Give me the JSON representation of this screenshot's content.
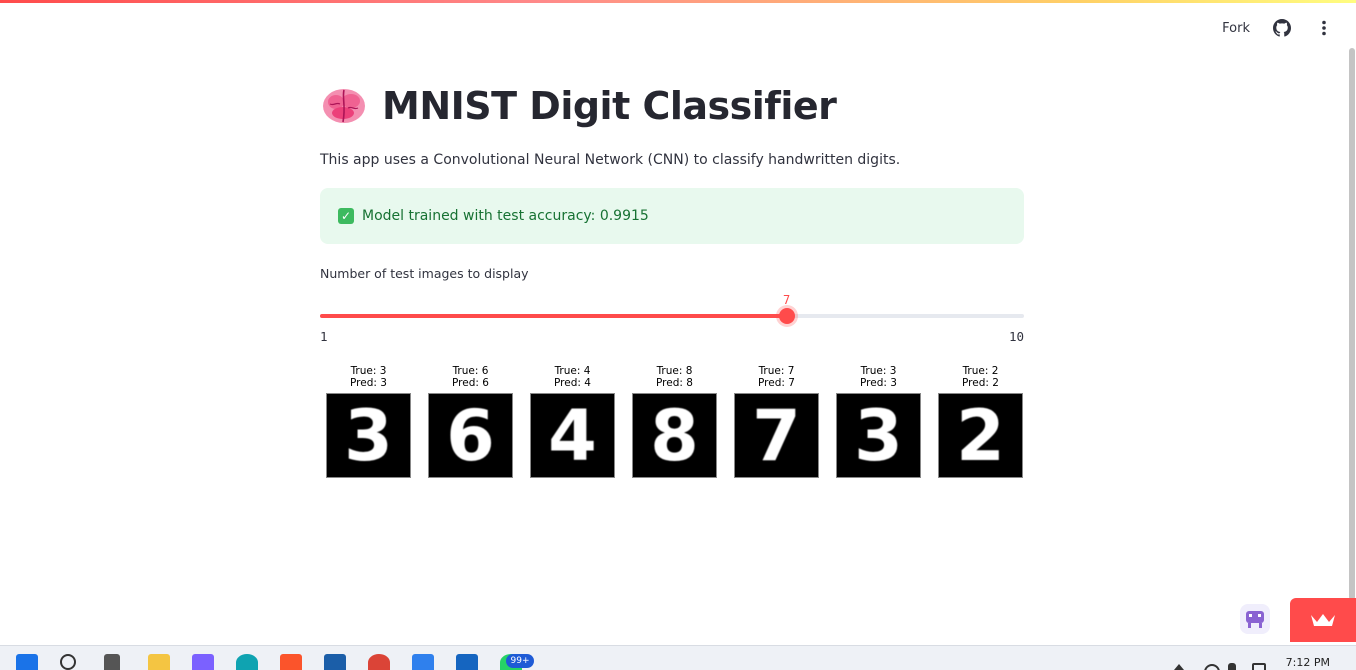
{
  "header": {
    "fork_label": "Fork",
    "icons": [
      "github-icon",
      "more-vertical-icon"
    ]
  },
  "app": {
    "title_emoji": "brain-icon",
    "title": "MNIST Digit Classifier",
    "description": "This app uses a Convolutional Neural Network (CNN) to classify handwritten digits.",
    "success_message": "Model trained with test accuracy: 0.9915",
    "slider": {
      "label": "Number of test images to display",
      "min": 1,
      "max": 10,
      "value": 7,
      "min_label": "1",
      "max_label": "10",
      "value_label": "7",
      "color": "#ff4b4b"
    },
    "samples": [
      {
        "true_label": "True: 3",
        "pred_label": "Pred: 3",
        "digit": "3"
      },
      {
        "true_label": "True: 6",
        "pred_label": "Pred: 6",
        "digit": "6"
      },
      {
        "true_label": "True: 4",
        "pred_label": "Pred: 4",
        "digit": "4"
      },
      {
        "true_label": "True: 8",
        "pred_label": "Pred: 8",
        "digit": "8"
      },
      {
        "true_label": "True: 7",
        "pred_label": "Pred: 7",
        "digit": "7"
      },
      {
        "true_label": "True: 3",
        "pred_label": "Pred: 3",
        "digit": "3"
      },
      {
        "true_label": "True: 2",
        "pred_label": "Pred: 2",
        "digit": "2"
      }
    ]
  },
  "taskbar": {
    "notification_badge": "99+",
    "clock": "7:12 PM"
  },
  "colors": {
    "accent": "#ff4b4b",
    "success_bg": "#e8f9ee",
    "success_text": "#177233"
  }
}
